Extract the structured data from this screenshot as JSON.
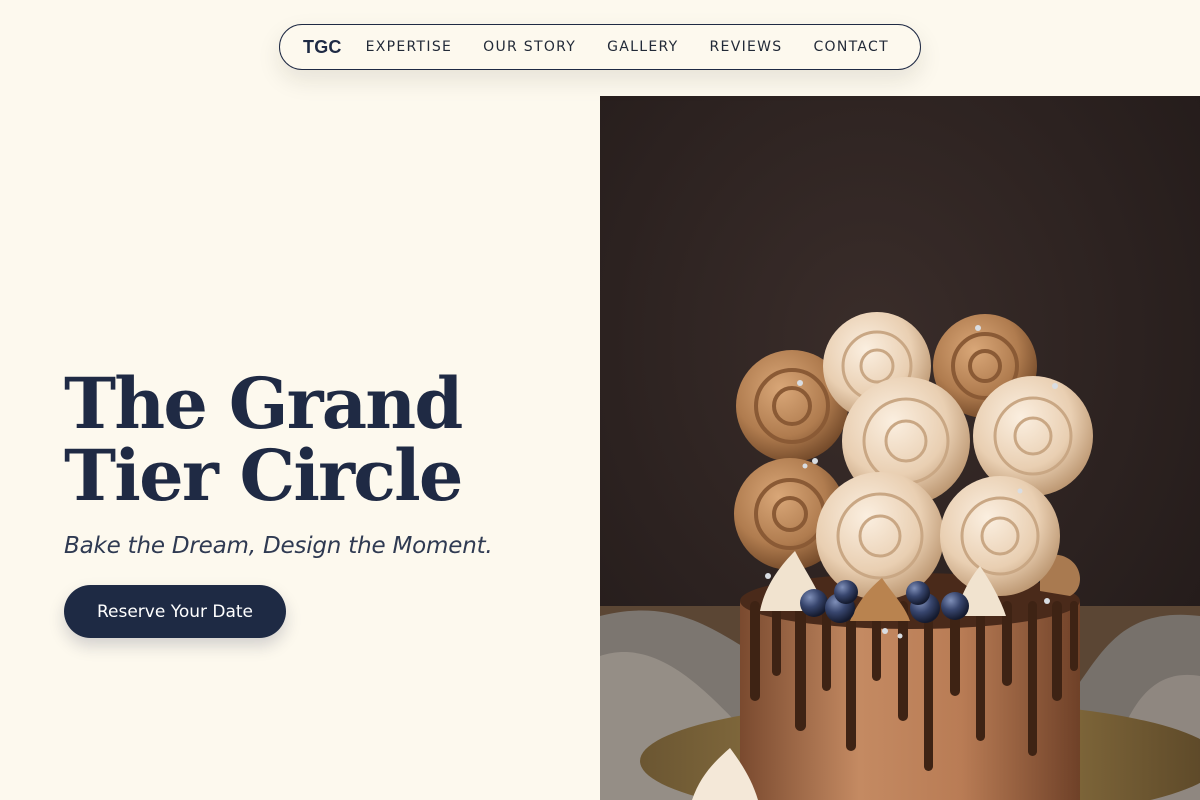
{
  "nav": {
    "logo": "TGC",
    "links": [
      "EXPERTISE",
      "OUR STORY",
      "GALLERY",
      "REVIEWS",
      "CONTACT"
    ]
  },
  "hero": {
    "title_line1": "The Grand",
    "title_line2": "Tier Circle",
    "tagline": "Bake the Dream, Design the Moment.",
    "cta_label": "Reserve Your Date"
  },
  "image": {
    "subject": "chocolate drip cake with meringue rosettes and blueberries"
  },
  "colors": {
    "background": "#fdf9ee",
    "navy": "#1e2a44",
    "photo_backdrop": "#2a2120"
  }
}
